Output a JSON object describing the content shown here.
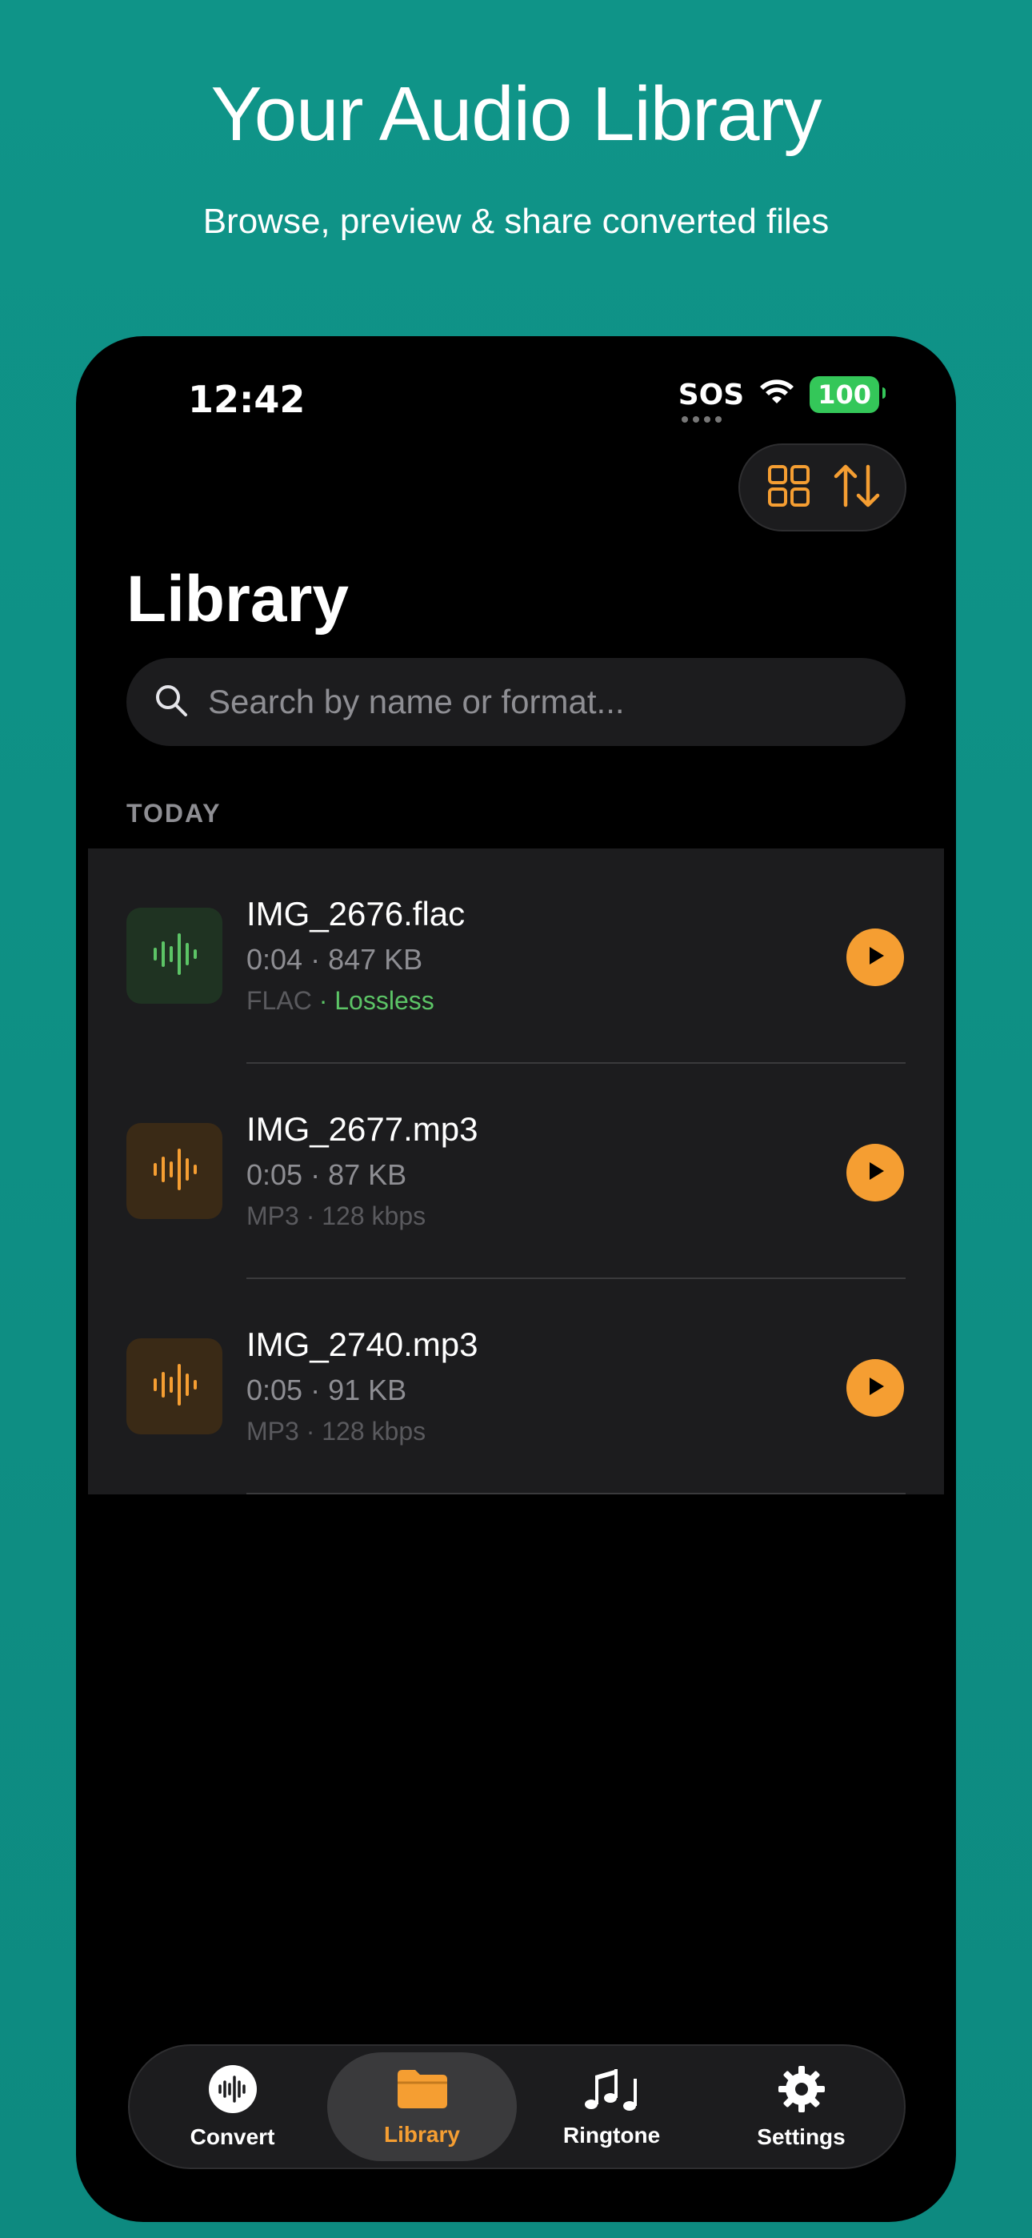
{
  "promo": {
    "headline": "Your Audio Library",
    "subhead": "Browse, preview & share converted files"
  },
  "status_bar": {
    "time": "12:42",
    "carrier": "SOS",
    "battery": "100"
  },
  "toolbar": {
    "grid_icon": "grid-icon",
    "sort_icon": "sort-icon"
  },
  "page": {
    "title": "Library"
  },
  "search": {
    "placeholder": "Search by name or format..."
  },
  "section": {
    "label": "TODAY"
  },
  "files": [
    {
      "name": "IMG_2676.flac",
      "duration": "0:04",
      "size": "847 KB",
      "format": "FLAC",
      "quality": "Lossless",
      "accent": "#5cc466"
    },
    {
      "name": "IMG_2677.mp3",
      "duration": "0:05",
      "size": "87 KB",
      "format": "MP3",
      "quality": "128 kbps",
      "accent": "#f59e32"
    },
    {
      "name": "IMG_2740.mp3",
      "duration": "0:05",
      "size": "91 KB",
      "format": "MP3",
      "quality": "128 kbps",
      "accent": "#f59e32"
    }
  ],
  "tabs": [
    {
      "label": "Convert",
      "icon": "waveform-circle-icon"
    },
    {
      "label": "Library",
      "icon": "folder-icon",
      "active": true
    },
    {
      "label": "Ringtone",
      "icon": "music-notes-icon"
    },
    {
      "label": "Settings",
      "icon": "gear-icon"
    }
  ],
  "colors": {
    "background": "#0f9488",
    "accent": "#f59e32",
    "success": "#5cc466"
  }
}
